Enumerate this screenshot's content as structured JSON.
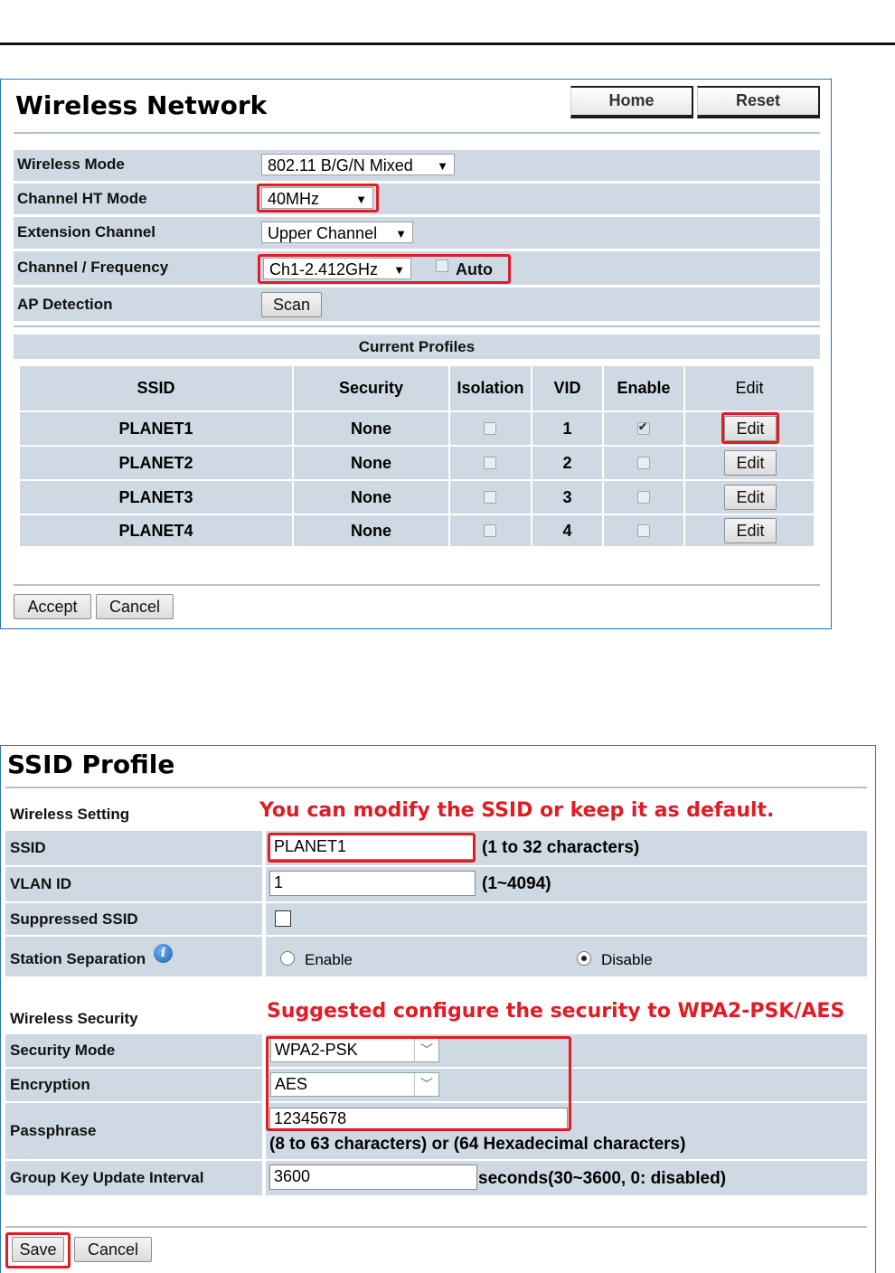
{
  "wireless_network": {
    "title": "Wireless Network",
    "home_label": "Home",
    "reset_label": "Reset",
    "settings": [
      {
        "label": "Wireless Mode",
        "value": "802.11 B/G/N Mixed"
      },
      {
        "label": "Channel HT Mode",
        "value": "40MHz"
      },
      {
        "label": "Extension Channel",
        "value": "Upper Channel"
      },
      {
        "label": "Channel / Frequency",
        "value": "Ch1-2.412GHz",
        "auto_label": "Auto"
      },
      {
        "label": "AP Detection",
        "button": "Scan"
      }
    ],
    "profiles_title": "Current Profiles",
    "columns": [
      "SSID",
      "Security",
      "Isolation",
      "VID",
      "Enable",
      "Edit"
    ],
    "rows": [
      {
        "ssid": "PLANET1",
        "security": "None",
        "vid": "1",
        "enabled": true,
        "edit": "Edit"
      },
      {
        "ssid": "PLANET2",
        "security": "None",
        "vid": "2",
        "enabled": false,
        "edit": "Edit"
      },
      {
        "ssid": "PLANET3",
        "security": "None",
        "vid": "3",
        "enabled": false,
        "edit": "Edit"
      },
      {
        "ssid": "PLANET4",
        "security": "None",
        "vid": "4",
        "enabled": false,
        "edit": "Edit"
      }
    ],
    "accept_label": "Accept",
    "cancel_label": "Cancel"
  },
  "ssid_profile": {
    "title": "SSID Profile",
    "wireless_setting_label": "Wireless Setting",
    "annotation_ssid": "You can modify the SSID or keep it as default.",
    "ssid_label": "SSID",
    "ssid_value": "PLANET1",
    "ssid_hint": "(1 to 32 characters)",
    "vlan_label": "VLAN ID",
    "vlan_value": "1",
    "vlan_hint": "(1~4094)",
    "suppressed_label": "Suppressed SSID",
    "separation_label": "Station Separation",
    "enable_label": "Enable",
    "disable_label": "Disable",
    "wireless_security_label": "Wireless Security",
    "annotation_security": "Suggested configure the security to WPA2-PSK/AES",
    "security_mode_label": "Security Mode",
    "security_mode_value": "WPA2-PSK",
    "encryption_label": "Encryption",
    "encryption_value": "AES",
    "passphrase_label": "Passphrase",
    "passphrase_value": "12345678",
    "passphrase_hint": "(8 to 63 characters) or (64 Hexadecimal characters)",
    "group_key_label": "Group Key Update Interval",
    "group_key_value": "3600",
    "group_key_hint": "seconds(30~3600, 0: disabled)",
    "save_label": "Save",
    "cancel_label": "Cancel"
  },
  "colors": {
    "accent_red": "#e31b23",
    "row_bg": "#cfd9e3",
    "panel_border": "#2f74b5"
  }
}
